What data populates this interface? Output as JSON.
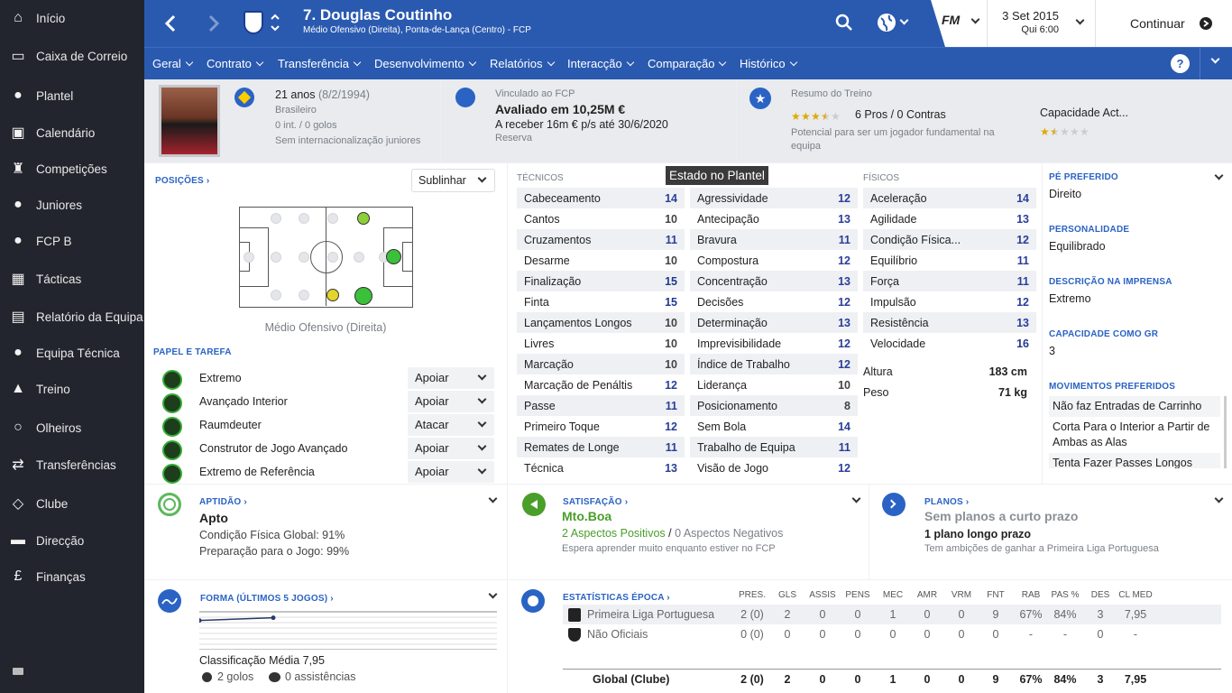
{
  "sidebar": {
    "items": [
      {
        "label": "Início",
        "icon": "home-icon"
      },
      {
        "label": "Caixa de Correio",
        "icon": "inbox-icon"
      },
      {
        "label": "Plantel",
        "icon": "people-icon"
      },
      {
        "label": "Calendário",
        "icon": "calendar-icon"
      },
      {
        "label": "Competições",
        "icon": "trophy-icon"
      },
      {
        "label": "Juniores",
        "icon": "juniors-icon"
      },
      {
        "label": "FCP B",
        "icon": "team-b-icon"
      },
      {
        "label": "Tácticas",
        "icon": "tactics-icon"
      },
      {
        "label": "Relatório da Equipa",
        "icon": "report-icon"
      },
      {
        "label": "Equipa Técnica",
        "icon": "staff-icon"
      },
      {
        "label": "Treino",
        "icon": "training-cone-icon"
      },
      {
        "label": "Olheiros",
        "icon": "search-icon"
      },
      {
        "label": "Transferências",
        "icon": "transfer-icon"
      },
      {
        "label": "Clube",
        "icon": "shield-icon"
      },
      {
        "label": "Direcção",
        "icon": "board-icon"
      },
      {
        "label": "Finanças",
        "icon": "pound-icon"
      }
    ]
  },
  "header": {
    "player_title": "7. Douglas Coutinho",
    "player_subtitle": "Médio Ofensivo (Direita), Ponta-de-Lança (Centro) - FCP",
    "date": "3 Set 2015",
    "time": "Qui 6:00",
    "continue_label": "Continuar",
    "fm_logo": "FM"
  },
  "nav": [
    "Geral",
    "Contrato",
    "Transferência",
    "Desenvolvimento",
    "Relatórios",
    "Interacção",
    "Comparação",
    "Histórico"
  ],
  "profile": {
    "age": "21 anos",
    "dob": "(8/2/1994)",
    "nationality": "Brasileiro",
    "caps": "0 int. / 0 golos",
    "youth": "Sem internacionalização juniores"
  },
  "contract": {
    "club_line": "Vinculado ao FCP",
    "value": "Avaliado em 10,25M €",
    "wage": "A receber 16m € p/s até 30/6/2020",
    "status": "Reserva"
  },
  "training": {
    "title": "Resumo do Treino",
    "potential_stars": 3.5,
    "ability_stars": 1.5,
    "pros_cons": "6 Pros / 0 Contras",
    "potential_text": "Potencial para ser um jogador fundamental na equipa",
    "ability_label": "Capacidade Act..."
  },
  "positions": {
    "label": "POSIÇÕES",
    "highlight_select": "Sublinhar",
    "position_name": "Médio Ofensivo (Direita)"
  },
  "roles": {
    "label": "PAPEL E TAREFA",
    "items": [
      {
        "name": "Extremo",
        "duty": "Apoiar"
      },
      {
        "name": "Avançado Interior",
        "duty": "Apoiar"
      },
      {
        "name": "Raumdeuter",
        "duty": "Atacar"
      },
      {
        "name": "Construtor de Jogo Avançado",
        "duty": "Apoiar"
      },
      {
        "name": "Extremo de Referência",
        "duty": "Apoiar"
      }
    ]
  },
  "tooltip": "Estado no Plantel",
  "attributes": {
    "technical_label": "TÉCNICOS",
    "physical_label": "FÍSICOS",
    "technical": [
      [
        "Cabeceamento",
        "14"
      ],
      [
        "Cantos",
        "10"
      ],
      [
        "Cruzamentos",
        "11"
      ],
      [
        "Desarme",
        "10"
      ],
      [
        "Finalização",
        "15"
      ],
      [
        "Finta",
        "15"
      ],
      [
        "Lançamentos Longos",
        "10"
      ],
      [
        "Livres",
        "10"
      ],
      [
        "Marcação",
        "10"
      ],
      [
        "Marcação de Penáltis",
        "12"
      ],
      [
        "Passe",
        "11"
      ],
      [
        "Primeiro Toque",
        "12"
      ],
      [
        "Remates de Longe",
        "11"
      ],
      [
        "Técnica",
        "13"
      ]
    ],
    "mental": [
      [
        "Agressividade",
        "12"
      ],
      [
        "Antecipação",
        "13"
      ],
      [
        "Bravura",
        "11"
      ],
      [
        "Compostura",
        "12"
      ],
      [
        "Concentração",
        "13"
      ],
      [
        "Decisões",
        "12"
      ],
      [
        "Determinação",
        "13"
      ],
      [
        "Imprevisibilidade",
        "12"
      ],
      [
        "Índice de Trabalho",
        "12"
      ],
      [
        "Liderança",
        "10"
      ],
      [
        "Posicionamento",
        "8"
      ],
      [
        "Sem Bola",
        "14"
      ],
      [
        "Trabalho de Equipa",
        "11"
      ],
      [
        "Visão de Jogo",
        "12"
      ]
    ],
    "physical": [
      [
        "Aceleração",
        "14"
      ],
      [
        "Agilidade",
        "13"
      ],
      [
        "Condição Física...",
        "12"
      ],
      [
        "Equilíbrio",
        "11"
      ],
      [
        "Força",
        "11"
      ],
      [
        "Impulsão",
        "12"
      ],
      [
        "Resistência",
        "13"
      ],
      [
        "Velocidade",
        "16"
      ]
    ],
    "height_label": "Altura",
    "height": "183 cm",
    "weight_label": "Peso",
    "weight": "71 kg"
  },
  "info": {
    "foot_label": "PÉ PREFERIDO",
    "foot": "Direito",
    "personality_label": "PERSONALIDADE",
    "personality": "Equilibrado",
    "media_label": "DESCRIÇÃO NA IMPRENSA",
    "media": "Extremo",
    "gk_label": "CAPACIDADE COMO GR",
    "gk": "3",
    "moves_label": "MOVIMENTOS PREFERIDOS",
    "moves": [
      "Não faz Entradas de Carrinho",
      "Corta Para o Interior a Partir de Ambas as Alas",
      "Tenta Fazer Passes Longos"
    ]
  },
  "fitness": {
    "label": "APTIDÃO",
    "status": "Apto",
    "line1": "Condição Física Global: 91%",
    "line2": "Preparação para o Jogo: 99%"
  },
  "satisfaction": {
    "label": "SATISFAÇÃO",
    "status": "Mto.Boa",
    "positives": "2 Aspectos Positivos",
    "sep": "/",
    "negatives": "0 Aspectos Negativos",
    "note": "Espera aprender muito enquanto estiver no FCP"
  },
  "plans": {
    "label": "PLANOS",
    "short": "Sem planos a curto prazo",
    "long": "1 plano longo prazo",
    "note": "Tem ambições de ganhar a Primeira Liga Portuguesa"
  },
  "form": {
    "label": "FORMA (ÚLTIMOS 5 JOGOS)",
    "avg": "Classificação Média 7,95",
    "goals": "2 golos",
    "assists": "0 assistências",
    "ratings": [
      7.7,
      7.95
    ]
  },
  "season_stats": {
    "label": "ESTATÍSTICAS ÉPOCA",
    "headers": [
      "PRES.",
      "GLS",
      "ASSIS",
      "PENS",
      "MEC",
      "AMR",
      "VRM",
      "FNT",
      "RAB",
      "PAS %",
      "DES",
      "CL MED"
    ],
    "rows": [
      {
        "comp": "Primeira Liga Portuguesa",
        "vals": [
          "2 (0)",
          "2",
          "0",
          "0",
          "1",
          "0",
          "0",
          "9",
          "67%",
          "84%",
          "3",
          "7,95"
        ]
      },
      {
        "comp": "Não Oficiais",
        "vals": [
          "0 (0)",
          "0",
          "0",
          "0",
          "0",
          "0",
          "0",
          "0",
          "-",
          "-",
          "0",
          "-"
        ]
      }
    ],
    "total": {
      "comp": "Global (Clube)",
      "vals": [
        "2 (0)",
        "2",
        "0",
        "0",
        "1",
        "0",
        "0",
        "9",
        "67%",
        "84%",
        "3",
        "7,95"
      ]
    }
  }
}
